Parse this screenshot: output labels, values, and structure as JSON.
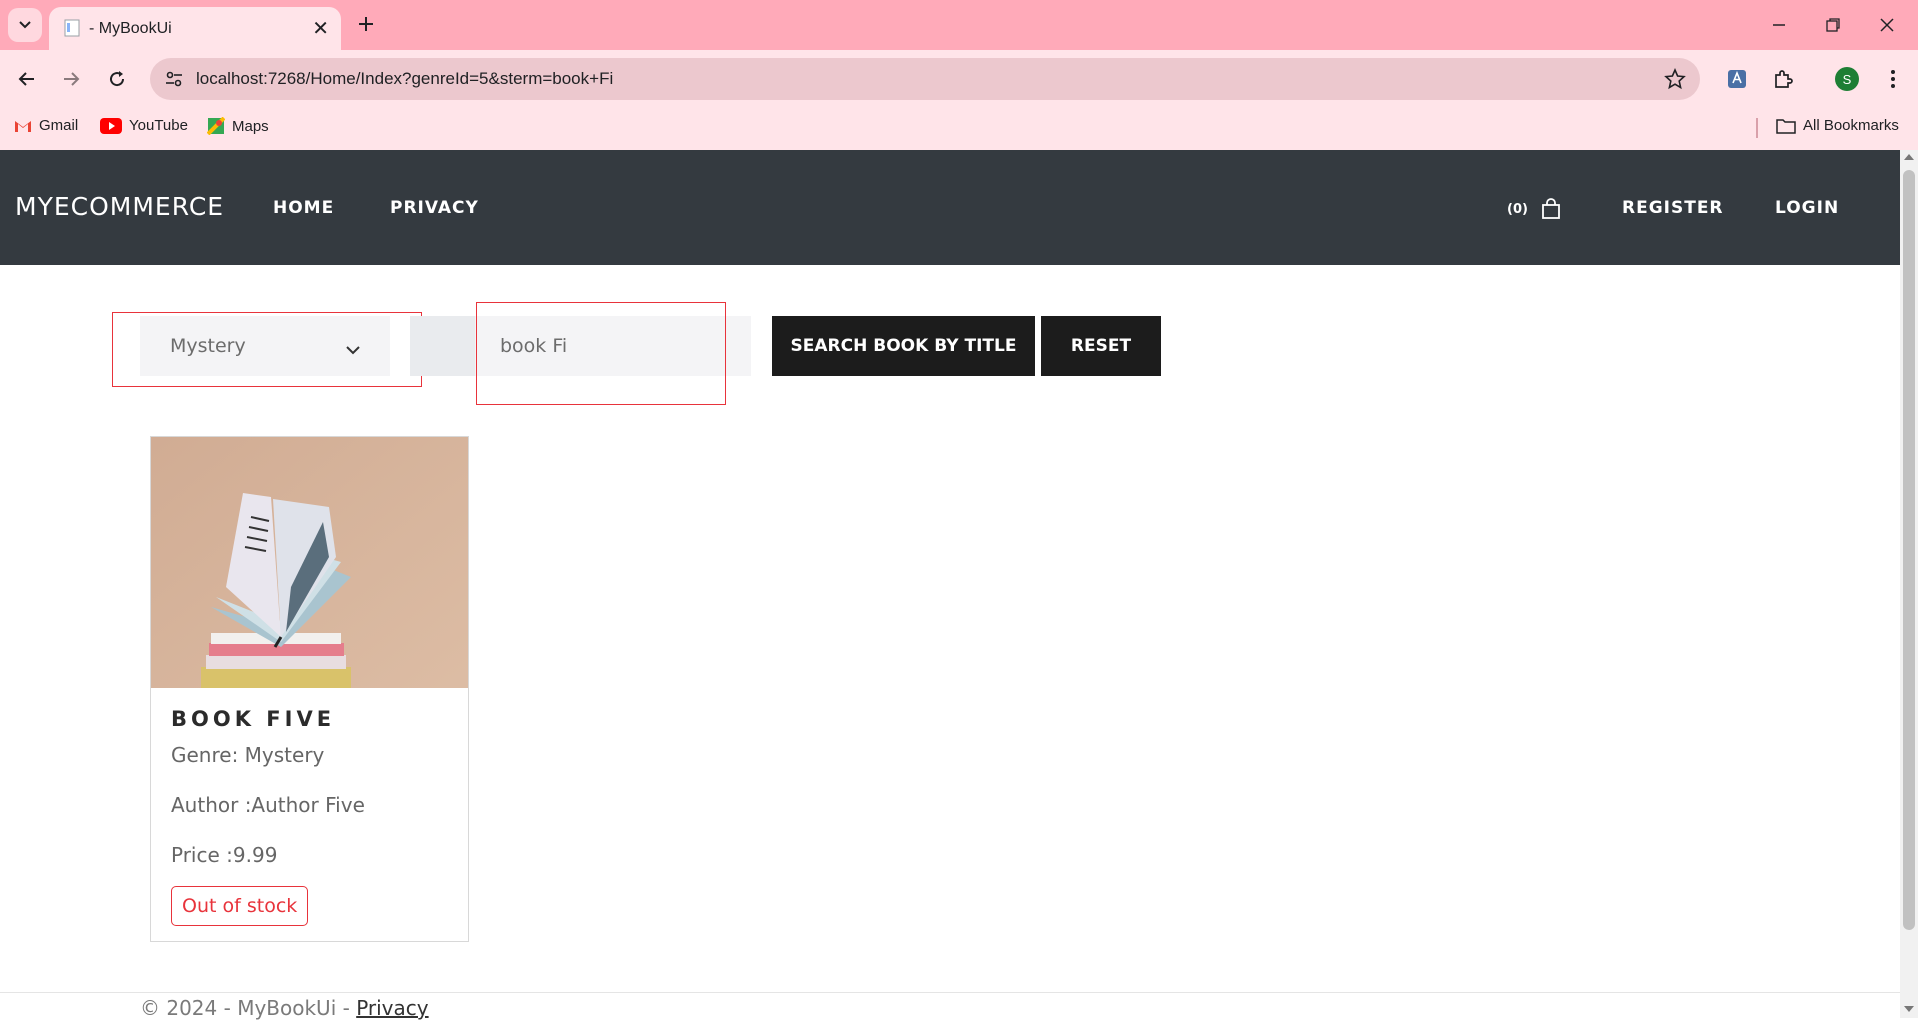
{
  "browser": {
    "tab_title": "- MyBookUi",
    "url": "localhost:7268/Home/Index?genreId=5&sterm=book+Fi",
    "profile_initial": "S",
    "bookmarks": [
      "Gmail",
      "YouTube",
      "Maps"
    ],
    "all_bookmarks": "All Bookmarks"
  },
  "nav": {
    "brand": "MYECOMMERCE",
    "links": [
      "HOME",
      "PRIVACY"
    ],
    "cart_count": "(0)",
    "register": "REGISTER",
    "login": "LOGIN"
  },
  "search": {
    "genre_selected": "Mystery",
    "term_value": "book Fi",
    "search_button": "SEARCH BOOK BY TITLE",
    "reset_button": "RESET"
  },
  "books": [
    {
      "title": "BOOK FIVE",
      "genre": "Genre: Mystery",
      "author": "Author :Author Five",
      "price": "Price :9.99",
      "stock_status": "Out of stock"
    }
  ],
  "footer": {
    "copyright": "© 2024 - MyBookUi - ",
    "privacy_link": "Privacy"
  },
  "colors": {
    "tabbar": "#ffaab9",
    "toolbar": "#ffe4e9",
    "navbar": "#343a40",
    "accent_red": "#e8333b",
    "button_dark": "#1c1c1c"
  }
}
